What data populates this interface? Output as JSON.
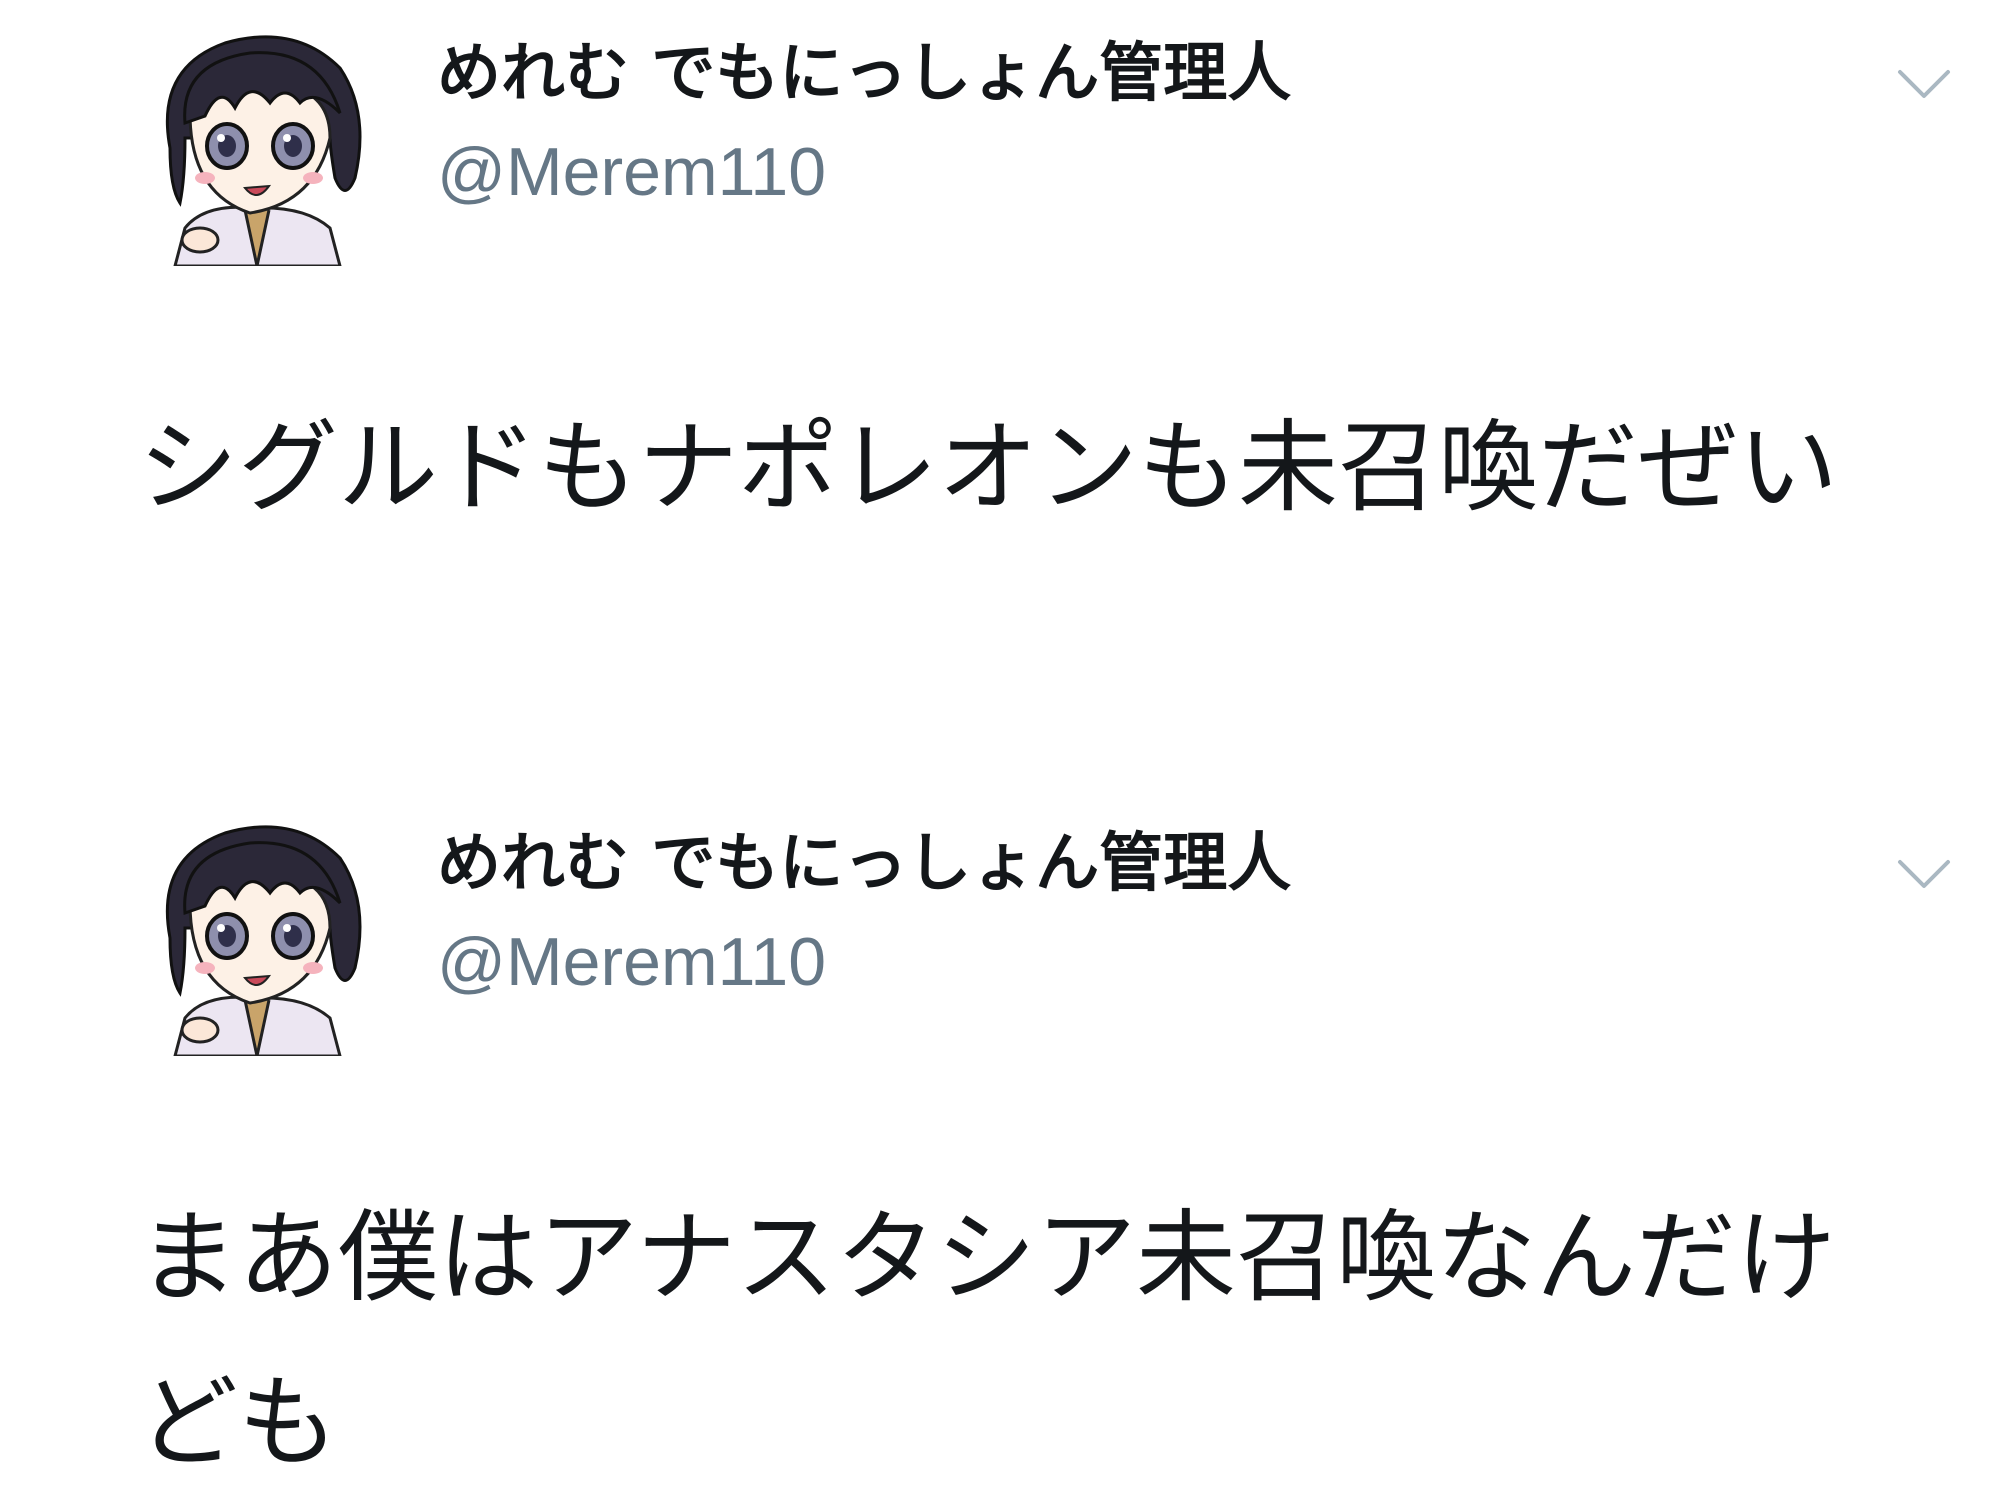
{
  "tweets": [
    {
      "author": {
        "display_name": "めれむ でもにっしょん管理人",
        "handle": "@Merem110",
        "avatar_icon": "chibi-character-avatar"
      },
      "menu_icon": "chevron-down-icon",
      "text": "シグルドもナポレオンも未召喚だぜい"
    },
    {
      "author": {
        "display_name": "めれむ でもにっしょん管理人",
        "handle": "@Merem110",
        "avatar_icon": "chibi-character-avatar"
      },
      "menu_icon": "chevron-down-icon",
      "text": "まあ僕はアナスタシア未召喚なんだけども"
    }
  ],
  "colors": {
    "text_primary": "#14171a",
    "text_secondary": "#657786",
    "caret": "#aab8c2",
    "background": "#ffffff"
  }
}
